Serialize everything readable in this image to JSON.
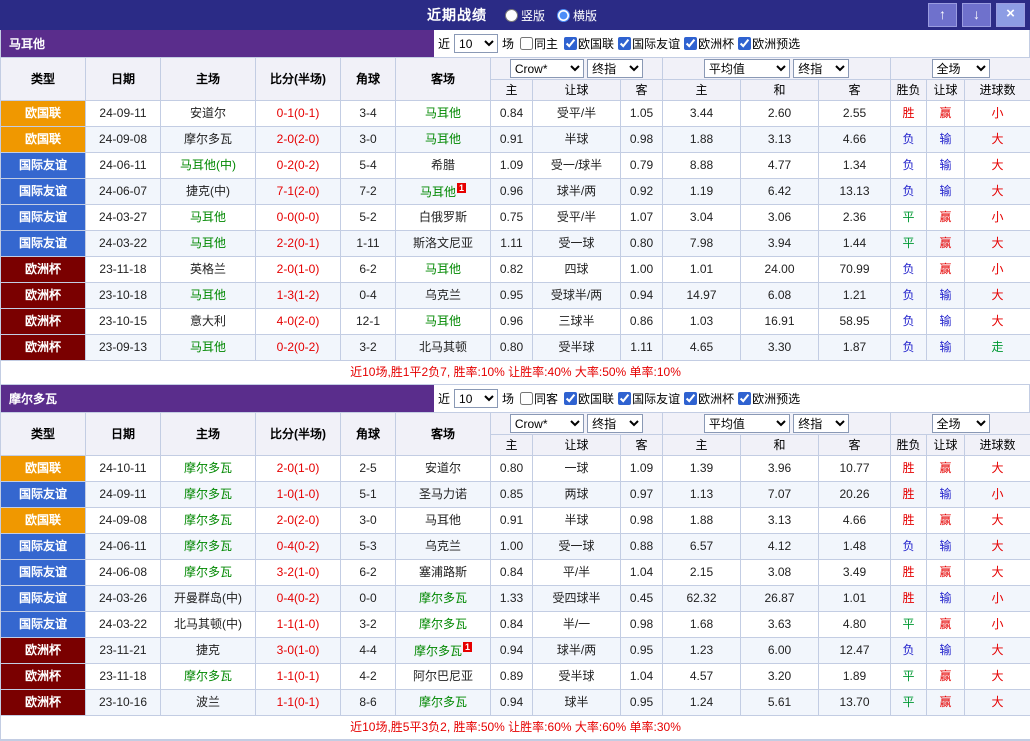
{
  "titlebar": {
    "title": "近期战绩",
    "radio_vertical": "竖版",
    "radio_horizontal": "横版",
    "horizontal_selected": true,
    "btn_up": "↑",
    "btn_down": "↓",
    "btn_close": "×"
  },
  "colors": {
    "titlebar_bg": "#2b2b86",
    "section_bar_bg": "#5a2d8c",
    "badge_nations_league": "#f09800",
    "badge_friendly": "#3567cf",
    "badge_euro_cup": "#7a0000",
    "featured_team": "#008800",
    "score_text": "#e50000",
    "result_red": "#e50000",
    "result_blue": "#2222cc",
    "result_green": "#009933"
  },
  "table_head": {
    "cols": [
      "类型",
      "日期",
      "主场",
      "比分(半场)",
      "角球",
      "客场"
    ],
    "sub": [
      "主",
      "让球",
      "客",
      "主",
      "和",
      "客",
      "胜负",
      "让球",
      "进球数"
    ],
    "sel_bookmaker": "Crow*",
    "sel_final": "终指",
    "sel_avg": "平均值",
    "sel_final2": "终指",
    "sel_scope": "全场"
  },
  "sections": [
    {
      "team": "马耳他",
      "filter": {
        "near": "近",
        "count": "10",
        "games": "场",
        "same_label": "同主",
        "same_checked": false,
        "comps": [
          {
            "label": "欧国联",
            "checked": true
          },
          {
            "label": "国际友谊",
            "checked": true
          },
          {
            "label": "欧洲杯",
            "checked": true
          },
          {
            "label": "欧洲预选",
            "checked": true
          }
        ]
      },
      "rows": [
        {
          "t": "欧国联",
          "tc": "n",
          "d": "24-09-11",
          "h": "安道尔",
          "hf": false,
          "s": "0-1(0-1)",
          "k": "3-4",
          "a": "马耳他",
          "af": true,
          "o1": "0.84",
          "hc": "受平/半",
          "o2": "1.05",
          "e1": "3.44",
          "e2": "2.60",
          "e3": "2.55",
          "r1": "胜",
          "c1": "r",
          "r2": "赢",
          "c2": "r",
          "r3": "小",
          "c3": "r"
        },
        {
          "t": "欧国联",
          "tc": "n",
          "d": "24-09-08",
          "h": "摩尔多瓦",
          "hf": false,
          "s": "2-0(2-0)",
          "k": "3-0",
          "a": "马耳他",
          "af": true,
          "o1": "0.91",
          "hc": "半球",
          "o2": "0.98",
          "e1": "1.88",
          "e2": "3.13",
          "e3": "4.66",
          "r1": "负",
          "c1": "b",
          "r2": "输",
          "c2": "b",
          "r3": "大",
          "c3": "r"
        },
        {
          "t": "国际友谊",
          "tc": "f",
          "d": "24-06-11",
          "h": "马耳他(中)",
          "hf": true,
          "s": "0-2(0-2)",
          "k": "5-4",
          "a": "希腊",
          "af": false,
          "o1": "1.09",
          "hc": "受一/球半",
          "o2": "0.79",
          "e1": "8.88",
          "e2": "4.77",
          "e3": "1.34",
          "r1": "负",
          "c1": "b",
          "r2": "输",
          "c2": "b",
          "r3": "大",
          "c3": "r"
        },
        {
          "t": "国际友谊",
          "tc": "f",
          "d": "24-06-07",
          "h": "捷克(中)",
          "hf": false,
          "s": "7-1(2-0)",
          "k": "7-2",
          "a": "马耳他",
          "af": true,
          "ar": true,
          "o1": "0.96",
          "hc": "球半/两",
          "o2": "0.92",
          "e1": "1.19",
          "e2": "6.42",
          "e3": "13.13",
          "r1": "负",
          "c1": "b",
          "r2": "输",
          "c2": "b",
          "r3": "大",
          "c3": "r"
        },
        {
          "t": "国际友谊",
          "tc": "f",
          "d": "24-03-27",
          "h": "马耳他",
          "hf": true,
          "s": "0-0(0-0)",
          "k": "5-2",
          "a": "白俄罗斯",
          "af": false,
          "o1": "0.75",
          "hc": "受平/半",
          "o2": "1.07",
          "e1": "3.04",
          "e2": "3.06",
          "e3": "2.36",
          "r1": "平",
          "c1": "g",
          "r2": "赢",
          "c2": "r",
          "r3": "小",
          "c3": "r"
        },
        {
          "t": "国际友谊",
          "tc": "f",
          "d": "24-03-22",
          "h": "马耳他",
          "hf": true,
          "s": "2-2(0-1)",
          "k": "1-11",
          "a": "斯洛文尼亚",
          "af": false,
          "o1": "1.11",
          "hc": "受一球",
          "o2": "0.80",
          "e1": "7.98",
          "e2": "3.94",
          "e3": "1.44",
          "r1": "平",
          "c1": "g",
          "r2": "赢",
          "c2": "r",
          "r3": "大",
          "c3": "r"
        },
        {
          "t": "欧洲杯",
          "tc": "e",
          "d": "23-11-18",
          "h": "英格兰",
          "hf": false,
          "s": "2-0(1-0)",
          "k": "6-2",
          "a": "马耳他",
          "af": true,
          "o1": "0.82",
          "hc": "四球",
          "o2": "1.00",
          "e1": "1.01",
          "e2": "24.00",
          "e3": "70.99",
          "r1": "负",
          "c1": "b",
          "r2": "赢",
          "c2": "r",
          "r3": "小",
          "c3": "r"
        },
        {
          "t": "欧洲杯",
          "tc": "e",
          "d": "23-10-18",
          "h": "马耳他",
          "hf": true,
          "s": "1-3(1-2)",
          "k": "0-4",
          "a": "乌克兰",
          "af": false,
          "o1": "0.95",
          "hc": "受球半/两",
          "o2": "0.94",
          "e1": "14.97",
          "e2": "6.08",
          "e3": "1.21",
          "r1": "负",
          "c1": "b",
          "r2": "输",
          "c2": "b",
          "r3": "大",
          "c3": "r"
        },
        {
          "t": "欧洲杯",
          "tc": "e",
          "d": "23-10-15",
          "h": "意大利",
          "hf": false,
          "s": "4-0(2-0)",
          "k": "12-1",
          "a": "马耳他",
          "af": true,
          "o1": "0.96",
          "hc": "三球半",
          "o2": "0.86",
          "e1": "1.03",
          "e2": "16.91",
          "e3": "58.95",
          "r1": "负",
          "c1": "b",
          "r2": "输",
          "c2": "b",
          "r3": "大",
          "c3": "r"
        },
        {
          "t": "欧洲杯",
          "tc": "e",
          "d": "23-09-13",
          "h": "马耳他",
          "hf": true,
          "s": "0-2(0-2)",
          "k": "3-2",
          "a": "北马其顿",
          "af": false,
          "o1": "0.80",
          "hc": "受半球",
          "o2": "1.11",
          "e1": "4.65",
          "e2": "3.30",
          "e3": "1.87",
          "r1": "负",
          "c1": "b",
          "r2": "输",
          "c2": "b",
          "r3": "走",
          "c3": "g"
        }
      ],
      "footer": "近10场,胜1平2负7, 胜率:10% 让胜率:40% 大率:50% 单率:10%"
    },
    {
      "team": "摩尔多瓦",
      "filter": {
        "near": "近",
        "count": "10",
        "games": "场",
        "same_label": "同客",
        "same_checked": false,
        "comps": [
          {
            "label": "欧国联",
            "checked": true
          },
          {
            "label": "国际友谊",
            "checked": true
          },
          {
            "label": "欧洲杯",
            "checked": true
          },
          {
            "label": "欧洲预选",
            "checked": true
          }
        ]
      },
      "rows": [
        {
          "t": "欧国联",
          "tc": "n",
          "d": "24-10-11",
          "h": "摩尔多瓦",
          "hf": true,
          "s": "2-0(1-0)",
          "k": "2-5",
          "a": "安道尔",
          "af": false,
          "o1": "0.80",
          "hc": "一球",
          "o2": "1.09",
          "e1": "1.39",
          "e2": "3.96",
          "e3": "10.77",
          "r1": "胜",
          "c1": "r",
          "r2": "赢",
          "c2": "r",
          "r3": "大",
          "c3": "r"
        },
        {
          "t": "国际友谊",
          "tc": "f",
          "d": "24-09-11",
          "h": "摩尔多瓦",
          "hf": true,
          "s": "1-0(1-0)",
          "k": "5-1",
          "a": "圣马力诺",
          "af": false,
          "o1": "0.85",
          "hc": "两球",
          "o2": "0.97",
          "e1": "1.13",
          "e2": "7.07",
          "e3": "20.26",
          "r1": "胜",
          "c1": "r",
          "r2": "输",
          "c2": "b",
          "r3": "小",
          "c3": "r"
        },
        {
          "t": "欧国联",
          "tc": "n",
          "d": "24-09-08",
          "h": "摩尔多瓦",
          "hf": true,
          "s": "2-0(2-0)",
          "k": "3-0",
          "a": "马耳他",
          "af": false,
          "o1": "0.91",
          "hc": "半球",
          "o2": "0.98",
          "e1": "1.88",
          "e2": "3.13",
          "e3": "4.66",
          "r1": "胜",
          "c1": "r",
          "r2": "赢",
          "c2": "r",
          "r3": "大",
          "c3": "r"
        },
        {
          "t": "国际友谊",
          "tc": "f",
          "d": "24-06-11",
          "h": "摩尔多瓦",
          "hf": true,
          "s": "0-4(0-2)",
          "k": "5-3",
          "a": "乌克兰",
          "af": false,
          "o1": "1.00",
          "hc": "受一球",
          "o2": "0.88",
          "e1": "6.57",
          "e2": "4.12",
          "e3": "1.48",
          "r1": "负",
          "c1": "b",
          "r2": "输",
          "c2": "b",
          "r3": "大",
          "c3": "r"
        },
        {
          "t": "国际友谊",
          "tc": "f",
          "d": "24-06-08",
          "h": "摩尔多瓦",
          "hf": true,
          "s": "3-2(1-0)",
          "k": "6-2",
          "a": "塞浦路斯",
          "af": false,
          "o1": "0.84",
          "hc": "平/半",
          "o2": "1.04",
          "e1": "2.15",
          "e2": "3.08",
          "e3": "3.49",
          "r1": "胜",
          "c1": "r",
          "r2": "赢",
          "c2": "r",
          "r3": "大",
          "c3": "r"
        },
        {
          "t": "国际友谊",
          "tc": "f",
          "d": "24-03-26",
          "h": "开曼群岛(中)",
          "hf": false,
          "s": "0-4(0-2)",
          "k": "0-0",
          "a": "摩尔多瓦",
          "af": true,
          "o1": "1.33",
          "hc": "受四球半",
          "o2": "0.45",
          "e1": "62.32",
          "e2": "26.87",
          "e3": "1.01",
          "r1": "胜",
          "c1": "r",
          "r2": "输",
          "c2": "b",
          "r3": "小",
          "c3": "r"
        },
        {
          "t": "国际友谊",
          "tc": "f",
          "d": "24-03-22",
          "h": "北马其顿(中)",
          "hf": false,
          "s": "1-1(1-0)",
          "k": "3-2",
          "a": "摩尔多瓦",
          "af": true,
          "o1": "0.84",
          "hc": "半/一",
          "o2": "0.98",
          "e1": "1.68",
          "e2": "3.63",
          "e3": "4.80",
          "r1": "平",
          "c1": "g",
          "r2": "赢",
          "c2": "r",
          "r3": "小",
          "c3": "r"
        },
        {
          "t": "欧洲杯",
          "tc": "e",
          "d": "23-11-21",
          "h": "捷克",
          "hf": false,
          "s": "3-0(1-0)",
          "k": "4-4",
          "a": "摩尔多瓦",
          "af": true,
          "ar": true,
          "o1": "0.94",
          "hc": "球半/两",
          "o2": "0.95",
          "e1": "1.23",
          "e2": "6.00",
          "e3": "12.47",
          "r1": "负",
          "c1": "b",
          "r2": "输",
          "c2": "b",
          "r3": "大",
          "c3": "r"
        },
        {
          "t": "欧洲杯",
          "tc": "e",
          "d": "23-11-18",
          "h": "摩尔多瓦",
          "hf": true,
          "s": "1-1(0-1)",
          "k": "4-2",
          "a": "阿尔巴尼亚",
          "af": false,
          "o1": "0.89",
          "hc": "受半球",
          "o2": "1.04",
          "e1": "4.57",
          "e2": "3.20",
          "e3": "1.89",
          "r1": "平",
          "c1": "g",
          "r2": "赢",
          "c2": "r",
          "r3": "大",
          "c3": "r"
        },
        {
          "t": "欧洲杯",
          "tc": "e",
          "d": "23-10-16",
          "h": "波兰",
          "hf": false,
          "s": "1-1(0-1)",
          "k": "8-6",
          "a": "摩尔多瓦",
          "af": true,
          "o1": "0.94",
          "hc": "球半",
          "o2": "0.95",
          "e1": "1.24",
          "e2": "5.61",
          "e3": "13.70",
          "r1": "平",
          "c1": "g",
          "r2": "赢",
          "c2": "r",
          "r3": "大",
          "c3": "r"
        }
      ],
      "footer": "近10场,胜5平3负2, 胜率:50% 让胜率:60% 大率:60% 单率:30%"
    }
  ]
}
